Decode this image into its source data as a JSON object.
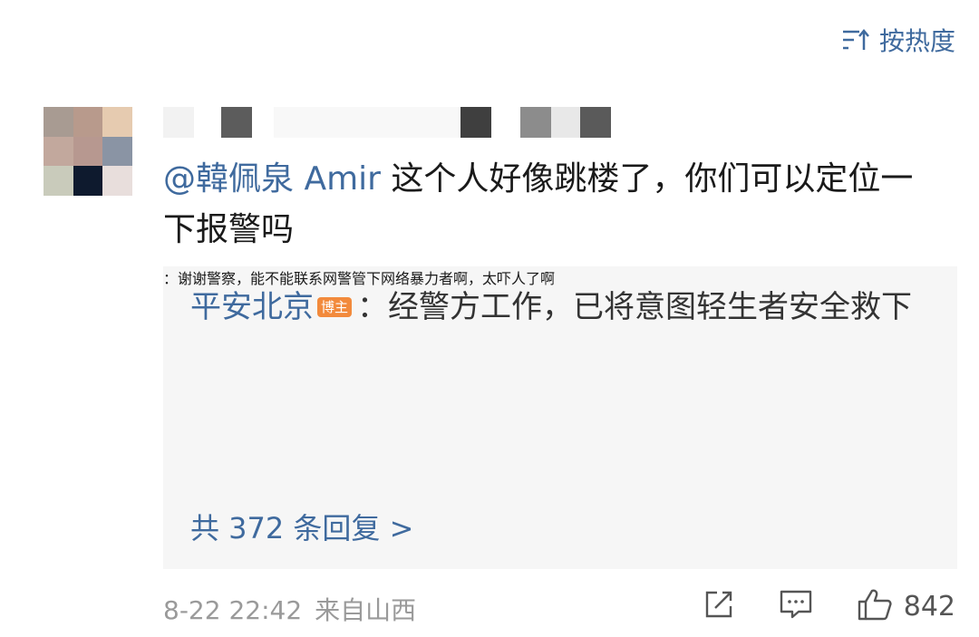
{
  "sort": {
    "label": "按热度",
    "icon": "sort-icon"
  },
  "comment": {
    "mention": "@韓佩泉 Amir",
    "text": " 这个人好像跳楼了，你们可以定位一下报警吗",
    "timestamp": "8-22 22:42",
    "location": "来自山西",
    "like_count": "842"
  },
  "replies": [
    {
      "author": "平安北京",
      "badge": "博主",
      "text": "：经警方工作，已将意图轻生者安全救下"
    },
    {
      "text": "：谢谢警察，能不能联系网警管下网络暴力者啊，太吓人了啊"
    }
  ],
  "more_replies": "共 372 条回复 >",
  "colors": {
    "link": "#3f6a9e",
    "badge": "#f28a3c",
    "reply_bg": "#f6f6f6",
    "meta": "#9a9a9a"
  }
}
